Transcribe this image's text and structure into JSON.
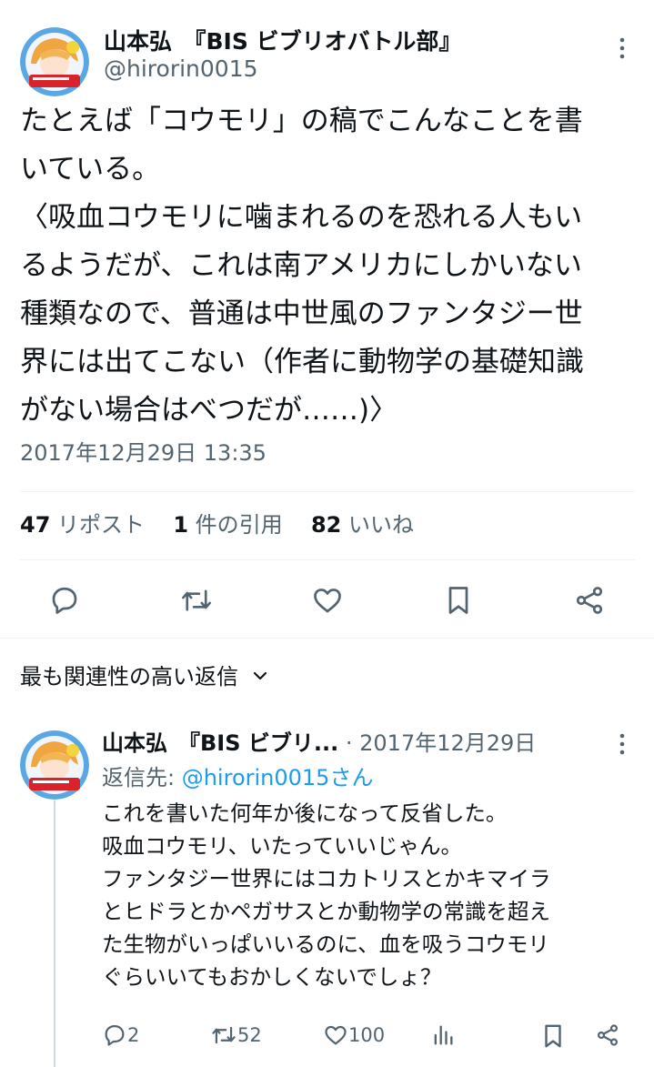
{
  "tweet": {
    "display_name": "山本弘　『BIS ビブリオバトル部』",
    "handle": "@hirorin0015",
    "body": "たとえば「コウモリ」の稿でこんなことを書\nいている。\n〈吸血コウモリに噛まれるのを恐れる人もい\nるようだが、これは南アメリカにしかいない\n種類なので、普通は中世風のファンタジー世\n界には出てこない（作者に動物学の基礎知識\nがない場合はべつだが……)〉",
    "timestamp": "2017年12月29日 13:35",
    "stats": {
      "reposts_count": "47",
      "reposts_label": "リポスト",
      "quotes_count": "1",
      "quotes_label": "件の引用",
      "likes_count": "82",
      "likes_label": "いいね"
    }
  },
  "actions": [
    "reply-icon",
    "repost-icon",
    "like-icon",
    "bookmark-icon",
    "share-icon"
  ],
  "sort": {
    "label": "最も関連性の高い返信"
  },
  "reply": {
    "display_name": "山本弘　『BIS ビブリ...",
    "separator": "·",
    "date": "2017年12月29日",
    "reply_to_prefix": "返信先: ",
    "reply_to_handle": "@hirorin0015さん",
    "body": "これを書いた何年か後になって反省した。\n吸血コウモリ、いたっていいじゃん。\nファンタジー世界にはコカトリスとかキマイラ\nとヒドラとかペガサスとか動物学の常識を超え\nた生物がいっぱいいるのに、血を吸うコウモリ\nぐらいいてもおかしくないでしょ？",
    "counts": {
      "replies": "2",
      "reposts": "52",
      "likes": "100"
    }
  },
  "colors": {
    "text": "#0f1419",
    "secondary": "#536471",
    "link": "#1d9bf0",
    "divider": "#eff3f4"
  }
}
